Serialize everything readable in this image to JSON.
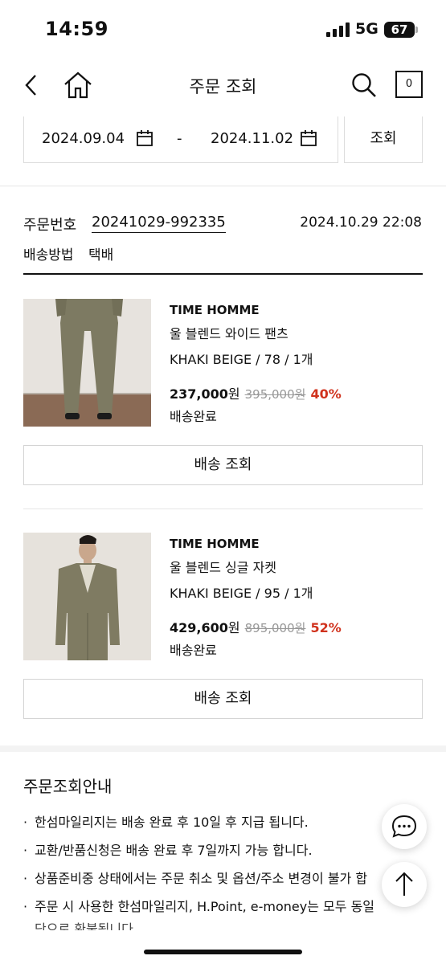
{
  "status_bar": {
    "time": "14:59",
    "network": "5G",
    "battery": "67"
  },
  "header": {
    "title": "주문 조회",
    "cart_count": "0"
  },
  "date_filter": {
    "start_date": "2024.09.04",
    "separator": "-",
    "end_date": "2024.11.02",
    "search_label": "조회"
  },
  "order": {
    "number_label": "주문번호",
    "number": "20241029-992335",
    "datetime": "2024.10.29 22:08",
    "shipping_label": "배송방법",
    "shipping_value": "택배"
  },
  "products": [
    {
      "brand": "TIME HOMME",
      "name": "울 블렌드 와이드 팬츠",
      "option": "KHAKI BEIGE / 78 / 1개",
      "price": "237,000",
      "price_unit": "원",
      "original_price": "395,000원",
      "discount": "40%",
      "status": "배송완료",
      "track_label": "배송 조회"
    },
    {
      "brand": "TIME HOMME",
      "name": "울 블렌드 싱글 자켓",
      "option": "KHAKI BEIGE / 95 / 1개",
      "price": "429,600",
      "price_unit": "원",
      "original_price": "895,000원",
      "discount": "52%",
      "status": "배송완료",
      "track_label": "배송 조회"
    }
  ],
  "info": {
    "title": "주문조회안내",
    "items": [
      "한섬마일리지는 배송 완료 후 10일 후 지급 됩니다.",
      "교환/반품신청은 배송 완료 후 7일까지 가능 합니다.",
      "상품준비중 상태에서는 주문 취소 및 옵션/주소 변경이 불가 합",
      "주문 시 사용한 한섬마일리지, H.Point, e-money는 모두 동일",
      "단으로 환불됩니다"
    ]
  },
  "icons": {
    "back": "chevron-left-icon",
    "home": "home-icon",
    "search": "search-icon",
    "calendar": "calendar-icon",
    "chat": "chat-icon",
    "scroll_top": "arrow-up-icon"
  },
  "colors": {
    "discount": "#d0321d",
    "text": "#111111",
    "border": "#dcdcdc",
    "muted": "#999999"
  }
}
